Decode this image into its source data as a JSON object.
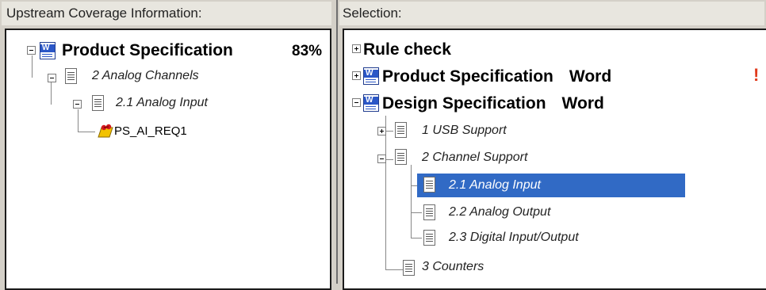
{
  "left_pane": {
    "header": "Upstream Coverage Information:",
    "root": {
      "label": "Product Specification",
      "percent": "83%"
    },
    "child1": {
      "label": "2 Analog Channels"
    },
    "child2": {
      "label": "2.1 Analog Input"
    },
    "child3": {
      "label": "PS_AI_REQ1"
    }
  },
  "right_pane": {
    "header": "Selection:",
    "items": [
      {
        "label": "Rule check",
        "type": ""
      },
      {
        "label": "Product Specification",
        "type": "Word"
      },
      {
        "label": "Design Specification",
        "type": "Word"
      },
      {
        "label": "1 USB Support"
      },
      {
        "label": "2 Channel Support"
      },
      {
        "label": "2.1 Analog Input"
      },
      {
        "label": "2.2 Analog Output"
      },
      {
        "label": "2.3 Digital Input/Output"
      },
      {
        "label": "3 Counters"
      }
    ],
    "warning_icon": "!"
  },
  "colors": {
    "selection": "#316ac5",
    "warning": "#e03a1c",
    "word_blue": "#2b57c7"
  }
}
